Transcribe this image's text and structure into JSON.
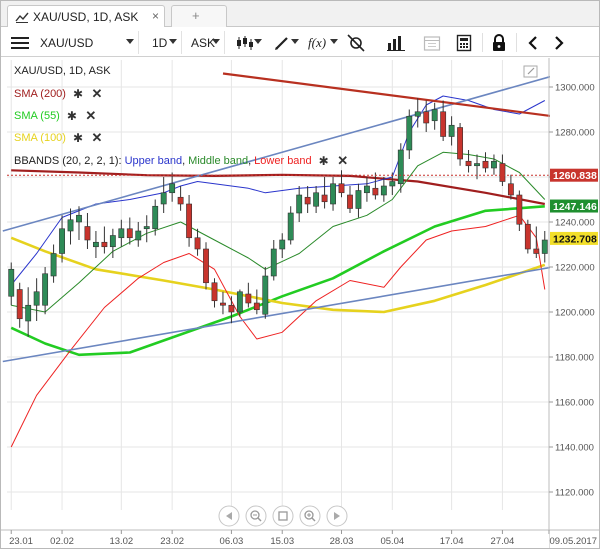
{
  "tabbar": {
    "tab_title": "XAU/USD, 1D, ASK",
    "close_glyph": "×",
    "new_tab_glyph": "+"
  },
  "toolbar": {
    "symbol": "XAU/USD",
    "period": "1D",
    "side": "ASK",
    "icons": [
      "menu-icon",
      "candlestick-icon",
      "draw-pencil-icon",
      "function-icon",
      "crosshair-icon",
      "volume-bars-icon",
      "calendar-icon",
      "calculator-icon",
      "lock-icon",
      "chevron-left-icon",
      "chevron-right-icon"
    ]
  },
  "legend": {
    "title": "XAU/USD, 1D, ASK",
    "sma200": "SMA (200)",
    "sma55": "SMA (55)",
    "sma100": "SMA (100)",
    "bbands_prefix": "BBANDS (20, 2, 2, 1):",
    "bb_upper": "Upper band",
    "bb_middle": "Middle band",
    "bb_lower": "Lower band",
    "comma": ",",
    "gear_glyph": "✱",
    "x_glyph": "✕"
  },
  "colors": {
    "background": "#ffffff",
    "grid": "#e6e6e6",
    "bull": "#2e8b57",
    "bear": "#c8342d",
    "sma200": "#a01e1e",
    "sma55": "#22cc22",
    "sma100": "#e6d21e",
    "bb_upper": "#2a35cc",
    "bb_middle": "#2a8a2a",
    "bb_lower": "#ee2222",
    "trendline": "#6b86c0",
    "resistance": "#b83020",
    "price_tag_red": "#c8342d",
    "price_tag_green": "#1f8f2f",
    "price_tag_yellow": "#f2df2a"
  },
  "chart_data": {
    "type": "candlestick",
    "symbol": "XAU/USD",
    "timeframe": "1D",
    "side": "ASK",
    "y_range": [
      1112,
      1312
    ],
    "y_ticks": [
      "1300.000",
      "1280.000",
      "1260.000",
      "1240.000",
      "1220.000",
      "1200.000",
      "1180.000",
      "1160.000",
      "1140.000",
      "1120.000"
    ],
    "x_labels": [
      "23.01",
      "02.02",
      "13.02",
      "23.02",
      "06.03",
      "15.03",
      "28.03",
      "05.04",
      "17.04",
      "27.04",
      "09.05.2017"
    ],
    "price_tags": [
      {
        "label": "1260.838",
        "value": 1260.8,
        "kind": "red"
      },
      {
        "label": "1247.146",
        "value": 1247.1,
        "kind": "green"
      },
      {
        "label": "1232.708",
        "value": 1232.7,
        "kind": "yellow"
      }
    ],
    "candles": [
      {
        "o": 1207,
        "h": 1222,
        "l": 1203,
        "c": 1219
      },
      {
        "o": 1210,
        "h": 1213,
        "l": 1193,
        "c": 1197
      },
      {
        "o": 1196,
        "h": 1211,
        "l": 1189,
        "c": 1203
      },
      {
        "o": 1203,
        "h": 1215,
        "l": 1196,
        "c": 1209
      },
      {
        "o": 1203,
        "h": 1220,
        "l": 1199,
        "c": 1217
      },
      {
        "o": 1216,
        "h": 1230,
        "l": 1213,
        "c": 1226
      },
      {
        "o": 1226,
        "h": 1243,
        "l": 1222,
        "c": 1237
      },
      {
        "o": 1236,
        "h": 1246,
        "l": 1230,
        "c": 1241
      },
      {
        "o": 1240,
        "h": 1247,
        "l": 1232,
        "c": 1243
      },
      {
        "o": 1238,
        "h": 1244,
        "l": 1228,
        "c": 1232
      },
      {
        "o": 1229,
        "h": 1236,
        "l": 1224,
        "c": 1231
      },
      {
        "o": 1231,
        "h": 1238,
        "l": 1226,
        "c": 1229
      },
      {
        "o": 1229,
        "h": 1237,
        "l": 1224,
        "c": 1234
      },
      {
        "o": 1233,
        "h": 1241,
        "l": 1229,
        "c": 1237
      },
      {
        "o": 1237,
        "h": 1242,
        "l": 1230,
        "c": 1233
      },
      {
        "o": 1232,
        "h": 1240,
        "l": 1229,
        "c": 1236
      },
      {
        "o": 1237,
        "h": 1243,
        "l": 1231,
        "c": 1238
      },
      {
        "o": 1237,
        "h": 1250,
        "l": 1234,
        "c": 1247
      },
      {
        "o": 1248,
        "h": 1260,
        "l": 1244,
        "c": 1253
      },
      {
        "o": 1253,
        "h": 1262,
        "l": 1249,
        "c": 1257
      },
      {
        "o": 1251,
        "h": 1256,
        "l": 1245,
        "c": 1248
      },
      {
        "o": 1248,
        "h": 1252,
        "l": 1229,
        "c": 1233
      },
      {
        "o": 1233,
        "h": 1237,
        "l": 1225,
        "c": 1228
      },
      {
        "o": 1228,
        "h": 1231,
        "l": 1210,
        "c": 1213
      },
      {
        "o": 1213,
        "h": 1215,
        "l": 1202,
        "c": 1205
      },
      {
        "o": 1204,
        "h": 1209,
        "l": 1199,
        "c": 1203
      },
      {
        "o": 1203,
        "h": 1207,
        "l": 1195,
        "c": 1200
      },
      {
        "o": 1200,
        "h": 1210,
        "l": 1198,
        "c": 1209
      },
      {
        "o": 1208,
        "h": 1213,
        "l": 1202,
        "c": 1204
      },
      {
        "o": 1204,
        "h": 1210,
        "l": 1199,
        "c": 1201
      },
      {
        "o": 1199,
        "h": 1220,
        "l": 1197,
        "c": 1216
      },
      {
        "o": 1216,
        "h": 1232,
        "l": 1214,
        "c": 1228
      },
      {
        "o": 1228,
        "h": 1235,
        "l": 1224,
        "c": 1232
      },
      {
        "o": 1232,
        "h": 1247,
        "l": 1230,
        "c": 1244
      },
      {
        "o": 1244,
        "h": 1256,
        "l": 1240,
        "c": 1252
      },
      {
        "o": 1251,
        "h": 1256,
        "l": 1244,
        "c": 1248
      },
      {
        "o": 1247,
        "h": 1256,
        "l": 1244,
        "c": 1253
      },
      {
        "o": 1252,
        "h": 1260,
        "l": 1246,
        "c": 1249
      },
      {
        "o": 1248,
        "h": 1260,
        "l": 1245,
        "c": 1257
      },
      {
        "o": 1257,
        "h": 1263,
        "l": 1251,
        "c": 1253
      },
      {
        "o": 1252,
        "h": 1256,
        "l": 1244,
        "c": 1246
      },
      {
        "o": 1246,
        "h": 1257,
        "l": 1242,
        "c": 1254
      },
      {
        "o": 1253,
        "h": 1260,
        "l": 1249,
        "c": 1256
      },
      {
        "o": 1255,
        "h": 1262,
        "l": 1250,
        "c": 1252
      },
      {
        "o": 1252,
        "h": 1260,
        "l": 1249,
        "c": 1256
      },
      {
        "o": 1256,
        "h": 1262,
        "l": 1252,
        "c": 1258
      },
      {
        "o": 1257,
        "h": 1275,
        "l": 1253,
        "c": 1272
      },
      {
        "o": 1272,
        "h": 1290,
        "l": 1268,
        "c": 1287
      },
      {
        "o": 1287,
        "h": 1295,
        "l": 1282,
        "c": 1289
      },
      {
        "o": 1289,
        "h": 1294,
        "l": 1280,
        "c": 1284
      },
      {
        "o": 1285,
        "h": 1293,
        "l": 1281,
        "c": 1290
      },
      {
        "o": 1289,
        "h": 1294,
        "l": 1276,
        "c": 1278
      },
      {
        "o": 1278,
        "h": 1287,
        "l": 1274,
        "c": 1283
      },
      {
        "o": 1282,
        "h": 1284,
        "l": 1265,
        "c": 1268
      },
      {
        "o": 1267,
        "h": 1272,
        "l": 1262,
        "c": 1265
      },
      {
        "o": 1265,
        "h": 1270,
        "l": 1259,
        "c": 1266
      },
      {
        "o": 1267,
        "h": 1271,
        "l": 1262,
        "c": 1264
      },
      {
        "o": 1264,
        "h": 1270,
        "l": 1261,
        "c": 1267
      },
      {
        "o": 1266,
        "h": 1270,
        "l": 1256,
        "c": 1258
      },
      {
        "o": 1257,
        "h": 1261,
        "l": 1250,
        "c": 1252
      },
      {
        "o": 1252,
        "h": 1254,
        "l": 1236,
        "c": 1239
      },
      {
        "o": 1239,
        "h": 1241,
        "l": 1226,
        "c": 1228
      },
      {
        "o": 1228,
        "h": 1238,
        "l": 1224,
        "c": 1226
      },
      {
        "o": 1226,
        "h": 1236,
        "l": 1222,
        "c": 1232
      }
    ],
    "series": [
      {
        "name": "SMA (200)",
        "points": [
          [
            0,
            1263
          ],
          [
            8,
            1262
          ],
          [
            16,
            1260.8
          ],
          [
            24,
            1260.5
          ],
          [
            32,
            1261
          ],
          [
            40,
            1260.5
          ],
          [
            48,
            1258
          ],
          [
            56,
            1253
          ],
          [
            63,
            1248
          ]
        ]
      },
      {
        "name": "SMA (55)",
        "points": [
          [
            0,
            1193
          ],
          [
            4,
            1186
          ],
          [
            8,
            1181
          ],
          [
            14,
            1182
          ],
          [
            20,
            1190
          ],
          [
            26,
            1198
          ],
          [
            32,
            1207
          ],
          [
            38,
            1215
          ],
          [
            44,
            1227
          ],
          [
            50,
            1238
          ],
          [
            56,
            1245
          ],
          [
            63,
            1247
          ]
        ]
      },
      {
        "name": "SMA (100)",
        "points": [
          [
            0,
            1233
          ],
          [
            4,
            1227
          ],
          [
            10,
            1219
          ],
          [
            18,
            1214
          ],
          [
            24,
            1210
          ],
          [
            32,
            1204
          ],
          [
            38,
            1201
          ],
          [
            44,
            1200
          ],
          [
            50,
            1205
          ],
          [
            56,
            1212
          ],
          [
            63,
            1221
          ]
        ]
      },
      {
        "name": "Upper band",
        "points": [
          [
            0,
            1212
          ],
          [
            3,
            1226
          ],
          [
            6,
            1242
          ],
          [
            10,
            1248
          ],
          [
            14,
            1250
          ],
          [
            18,
            1253
          ],
          [
            20,
            1256
          ],
          [
            22,
            1258
          ],
          [
            24,
            1257
          ],
          [
            28,
            1255
          ],
          [
            30,
            1253
          ],
          [
            34,
            1255
          ],
          [
            38,
            1256
          ],
          [
            42,
            1257
          ],
          [
            45,
            1260
          ],
          [
            47,
            1280
          ],
          [
            49,
            1292
          ],
          [
            51,
            1296
          ],
          [
            54,
            1294
          ],
          [
            57,
            1290
          ],
          [
            60,
            1288
          ],
          [
            63,
            1294
          ]
        ]
      },
      {
        "name": "Middle band",
        "points": [
          [
            0,
            1203
          ],
          [
            4,
            1200
          ],
          [
            8,
            1213
          ],
          [
            12,
            1227
          ],
          [
            16,
            1235
          ],
          [
            20,
            1240
          ],
          [
            24,
            1232
          ],
          [
            28,
            1224
          ],
          [
            30,
            1219
          ],
          [
            34,
            1226
          ],
          [
            38,
            1238
          ],
          [
            42,
            1243
          ],
          [
            45,
            1250
          ],
          [
            48,
            1265
          ],
          [
            51,
            1271
          ],
          [
            54,
            1270
          ],
          [
            57,
            1268
          ],
          [
            60,
            1262
          ],
          [
            63,
            1250
          ]
        ]
      },
      {
        "name": "Lower band",
        "points": [
          [
            0,
            1140
          ],
          [
            3,
            1163
          ],
          [
            7,
            1183
          ],
          [
            11,
            1202
          ],
          [
            15,
            1215
          ],
          [
            18,
            1222
          ],
          [
            21,
            1226
          ],
          [
            24,
            1219
          ],
          [
            27,
            1198
          ],
          [
            29,
            1188
          ],
          [
            32,
            1191
          ],
          [
            36,
            1205
          ],
          [
            40,
            1214
          ],
          [
            44,
            1211
          ],
          [
            46,
            1220
          ],
          [
            49,
            1232
          ],
          [
            52,
            1236
          ],
          [
            56,
            1238
          ],
          [
            60,
            1243
          ],
          [
            62,
            1233
          ],
          [
            63,
            1210
          ]
        ]
      },
      {
        "name": "",
        "points": [
          [
            -1,
            1236
          ],
          [
            64,
            1305
          ]
        ]
      },
      {
        "name": "",
        "points": [
          [
            -1,
            1178
          ],
          [
            64,
            1220
          ]
        ]
      },
      {
        "name": "",
        "points": [
          [
            25,
            1306
          ],
          [
            64,
            1287
          ]
        ]
      }
    ]
  },
  "nav": {
    "buttons": [
      "scroll-left-icon",
      "zoom-out-icon",
      "reset-icon",
      "zoom-in-icon",
      "scroll-right-icon"
    ]
  }
}
